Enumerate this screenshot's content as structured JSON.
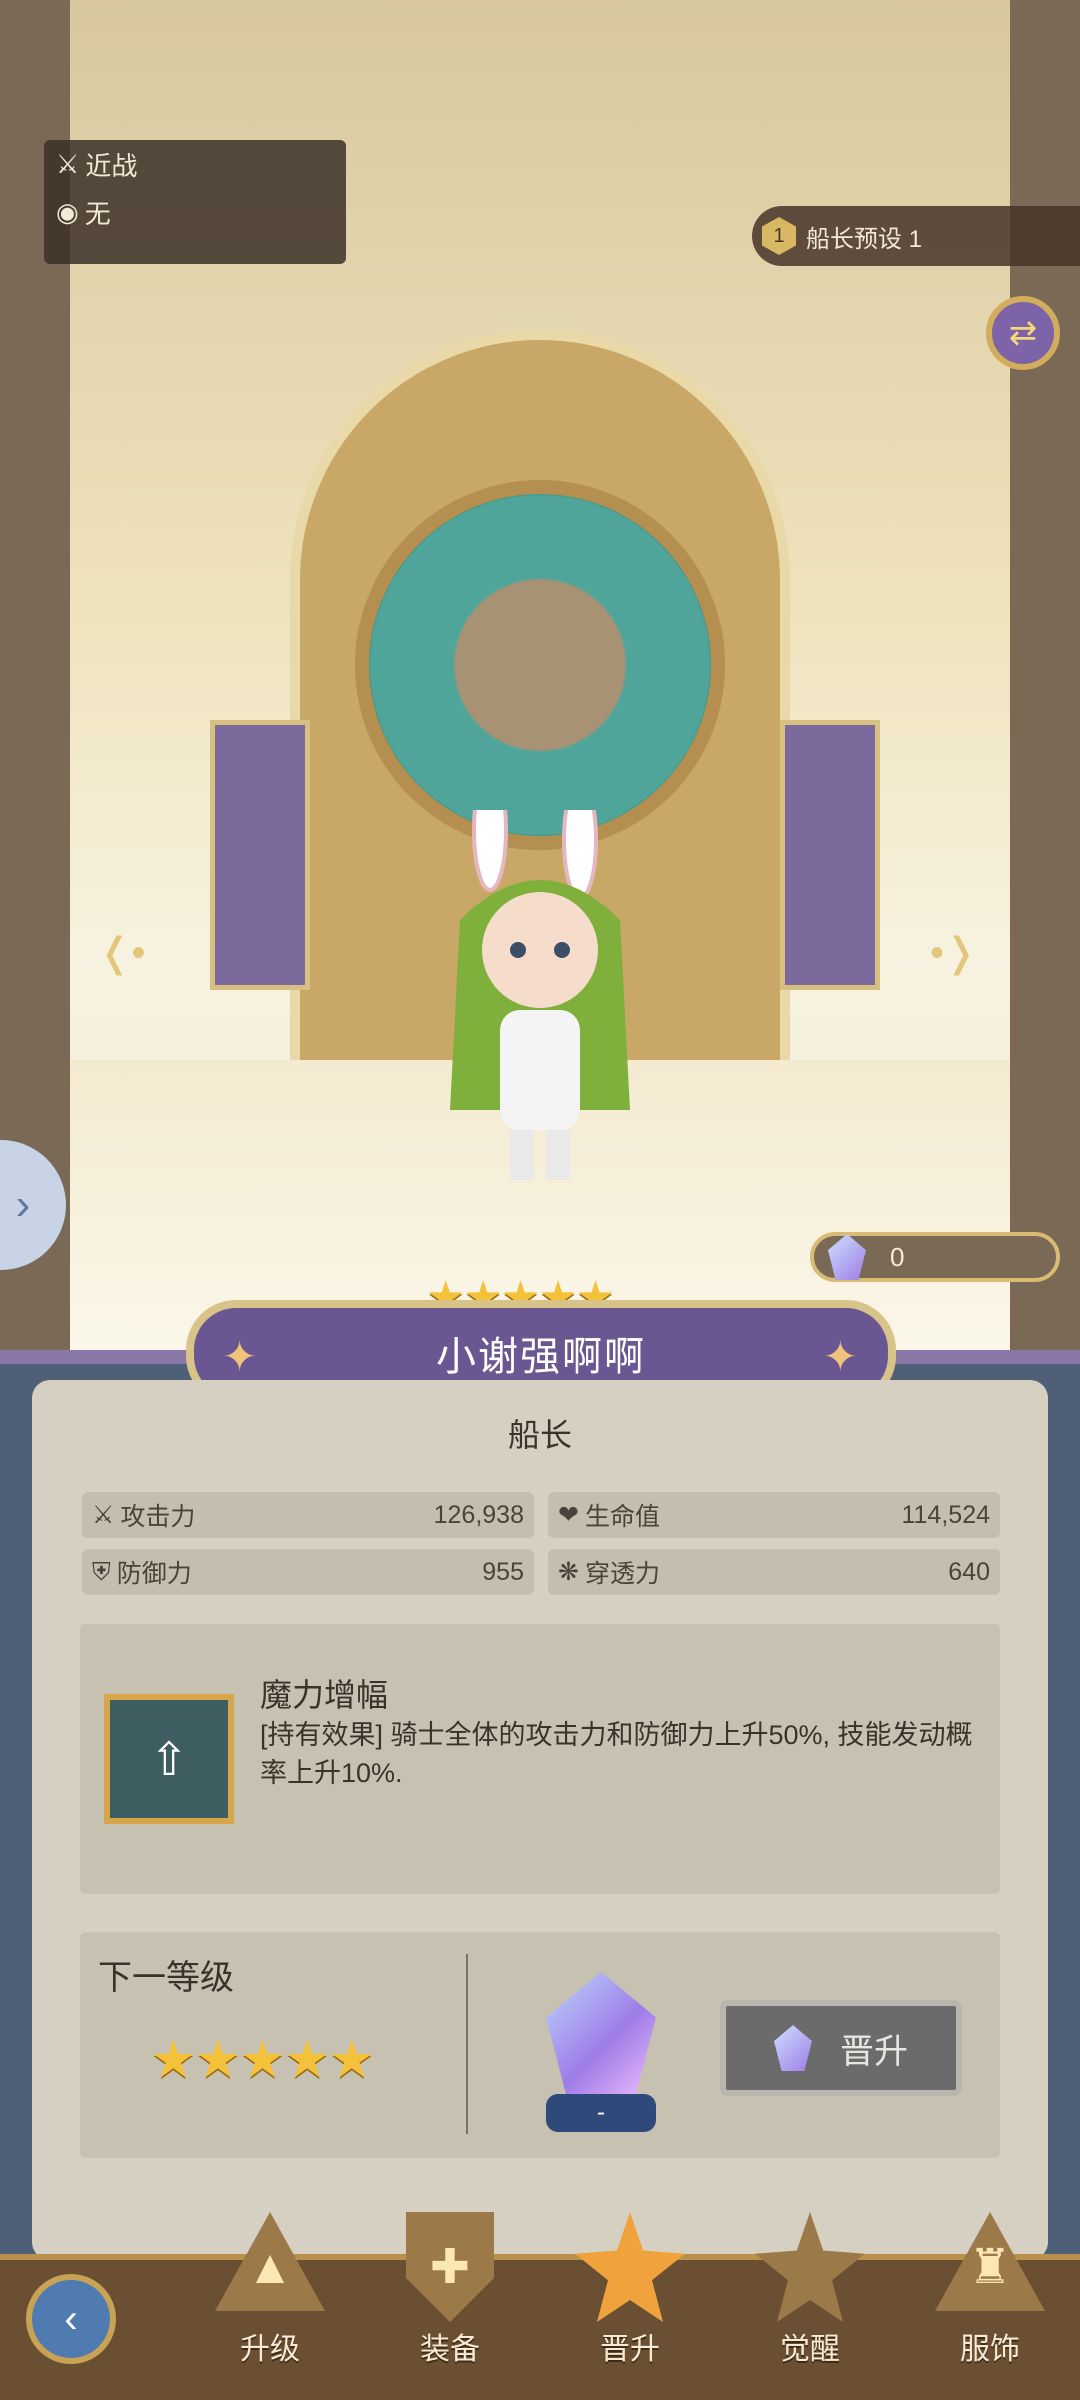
{
  "hero": {
    "attack_type": "近战",
    "element": "无",
    "preset_number": "1",
    "preset_label": "船长预设 1",
    "crystal_count": "0",
    "stars_display": "★★★★★",
    "name": "小谢强啊啊",
    "role": "船长"
  },
  "stats": [
    {
      "label": "攻击力",
      "value": "126,938",
      "icon": "sword-icon"
    },
    {
      "label": "生命值",
      "value": "114,524",
      "icon": "heart-icon"
    },
    {
      "label": "防御力",
      "value": "955",
      "icon": "shield-icon"
    },
    {
      "label": "穿透力",
      "value": "640",
      "icon": "pierce-icon"
    }
  ],
  "skill": {
    "title": "魔力增幅",
    "description": "[持有效果] 骑士全体的攻击力和防御力上升50%, 技能发动概率上升10%."
  },
  "next": {
    "title": "下一等级",
    "stars_display": "★★★★★",
    "cost_value": "-",
    "button_label": "晋升"
  },
  "tabs": [
    {
      "label": "升级",
      "icon": "upgrade-icon"
    },
    {
      "label": "装备",
      "icon": "equipment-icon"
    },
    {
      "label": "晋升",
      "icon": "promote-star-icon",
      "active": true
    },
    {
      "label": "觉醒",
      "icon": "awaken-icon"
    },
    {
      "label": "服饰",
      "icon": "costume-icon"
    }
  ],
  "colors": {
    "accent_purple": "#6a5792",
    "gold": "#d8c389",
    "star_yellow": "#f3c23a",
    "panel_bg": "#d6d0c2"
  }
}
